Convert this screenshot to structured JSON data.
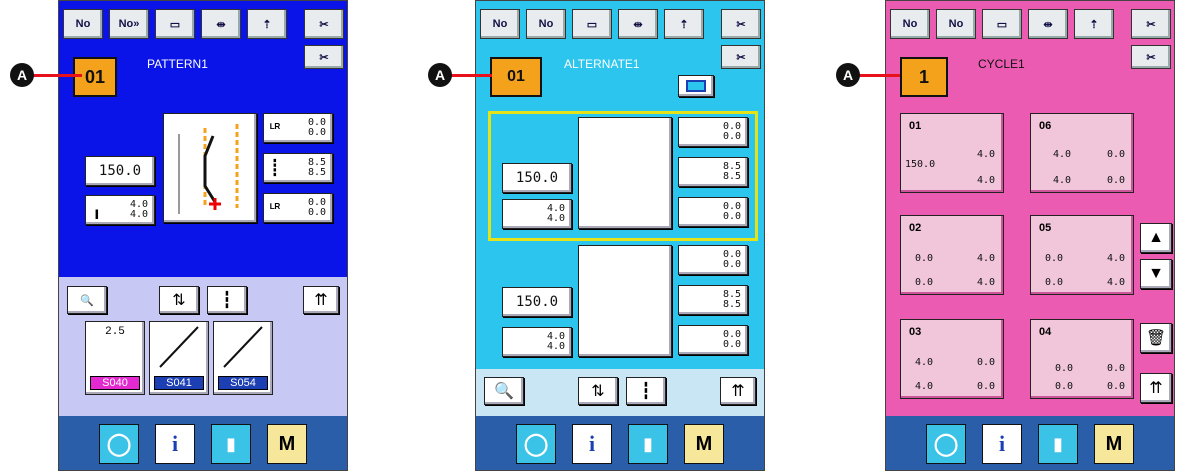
{
  "callout_letter": "A",
  "panels": [
    {
      "title": "PATTERN1",
      "color": "#0a14e8",
      "pattern_btn": "01",
      "value_left": "150.0",
      "val_lr_top": [
        "0.0",
        "0.0"
      ],
      "val_lr_mid": [
        "8.5",
        "8.5"
      ],
      "val_lr_bot": [
        "0.0",
        "0.0"
      ],
      "val_small": [
        "4.0",
        "4.0"
      ],
      "stitches": [
        {
          "num": "2.5",
          "code": "S040",
          "color": "#e32ad0"
        },
        {
          "num": "",
          "code": "S041",
          "color": "#1d3fb4"
        },
        {
          "num": "",
          "code": "S054",
          "color": "#1d3fb4"
        }
      ]
    },
    {
      "title": "ALTERNATE1",
      "color": "#2bc5ee",
      "pattern_btn": "01",
      "upper": {
        "value": "150.0",
        "top": [
          "0.0",
          "0.0"
        ],
        "mid": [
          "8.5",
          "8.5"
        ],
        "bot": [
          "0.0",
          "0.0"
        ],
        "small": [
          "4.0",
          "4.0"
        ]
      },
      "lower": {
        "value": "150.0",
        "top": [
          "0.0",
          "0.0"
        ],
        "mid": [
          "8.5",
          "8.5"
        ],
        "bot": [
          "0.0",
          "0.0"
        ],
        "small": [
          "4.0",
          "4.0"
        ]
      }
    },
    {
      "title": "CYCLE1",
      "color": "#ea5bb1",
      "pattern_btn": "1",
      "cells": [
        {
          "label": "01",
          "left": [
            "150.0"
          ],
          "right": [
            "4.0",
            "4.0"
          ]
        },
        {
          "label": "06",
          "left": [
            "4.0",
            "4.0"
          ],
          "right": [
            "0.0",
            "0.0"
          ]
        },
        {
          "label": "02",
          "left": [
            "0.0",
            "0.0"
          ],
          "right": [
            "4.0",
            "4.0"
          ]
        },
        {
          "label": "05",
          "left": [
            "0.0",
            "0.0"
          ],
          "right": [
            "4.0",
            "4.0"
          ]
        },
        {
          "label": "03",
          "left": [
            "4.0",
            "4.0"
          ],
          "right": [
            "0.0",
            "0.0"
          ]
        },
        {
          "label": "04",
          "left": [
            "0.0",
            "0.0"
          ],
          "right": [
            "0.0",
            "0.0"
          ]
        }
      ]
    }
  ],
  "bottom_bar": {
    "m_label": "M"
  }
}
